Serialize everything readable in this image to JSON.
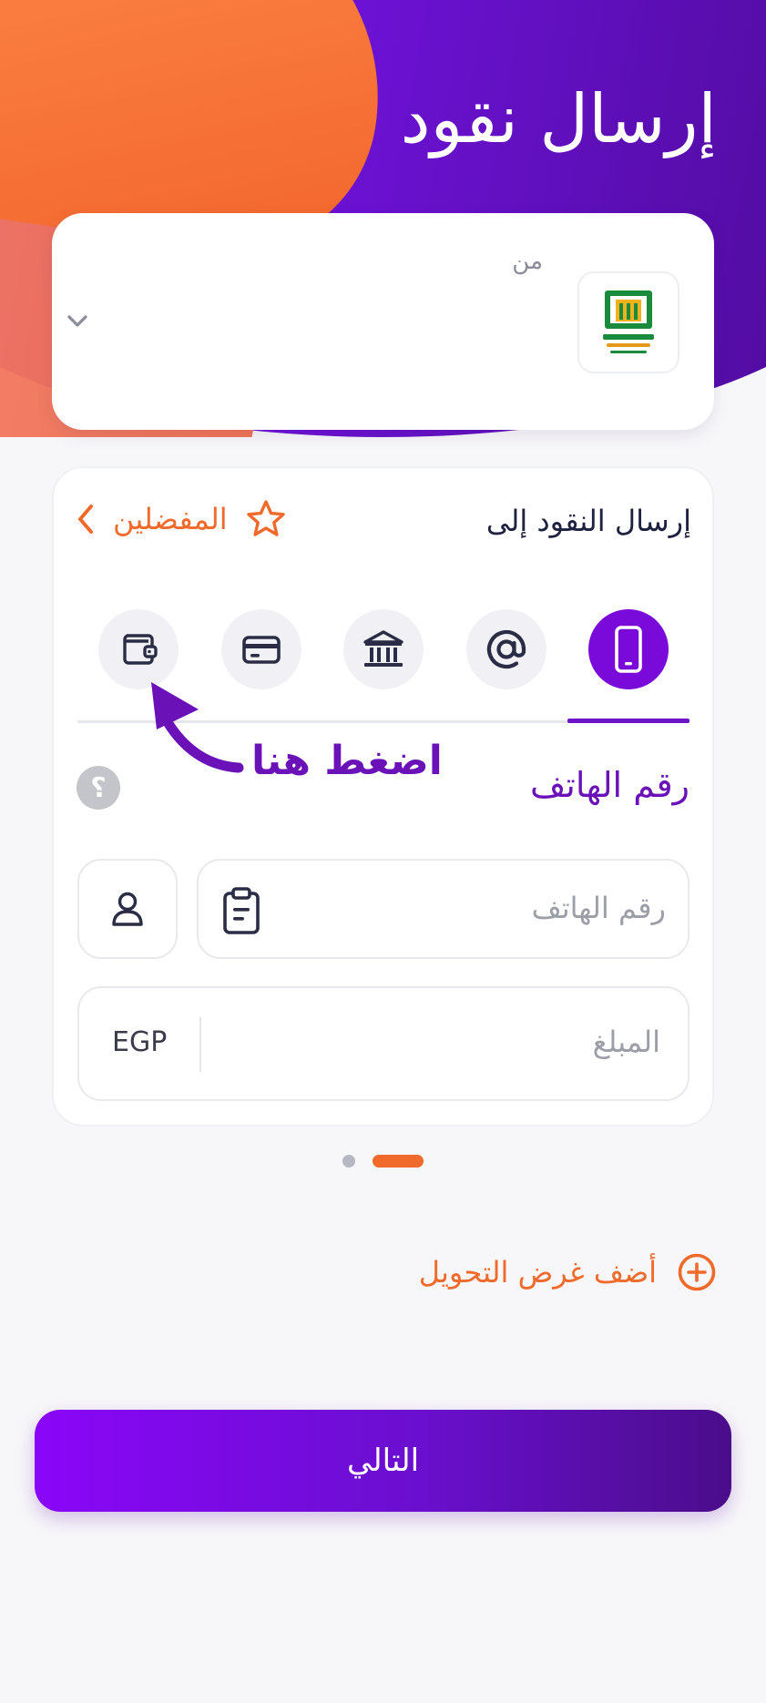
{
  "header": {
    "title": "إرسال نقود"
  },
  "from_card": {
    "label": "من",
    "bank_logo_icon": "bank-logo-icon",
    "dropdown_icon": "chevron-down-icon"
  },
  "send_card": {
    "title": "إرسال النقود إلى",
    "favorites_label": "المفضلين",
    "methods": [
      {
        "icon": "phone-icon",
        "active": true
      },
      {
        "icon": "at-sign-icon",
        "active": false
      },
      {
        "icon": "bank-icon",
        "active": false
      },
      {
        "icon": "card-icon",
        "active": false
      },
      {
        "icon": "wallet-icon",
        "active": false
      }
    ],
    "annotation": "اضغط هنا",
    "section_label": "رقم الهاتف",
    "help_glyph": "؟",
    "phone_placeholder": "رقم الهاتف",
    "amount_placeholder": "المبلغ",
    "currency": "EGP"
  },
  "pager": {
    "total": 2,
    "active_index": 1
  },
  "add_purpose_label": "أضف غرض التحويل",
  "next_label": "التالي",
  "colors": {
    "primary_purple": "#7a0ad9",
    "accent_orange": "#f06a2b",
    "background": "#f7f7f9"
  }
}
